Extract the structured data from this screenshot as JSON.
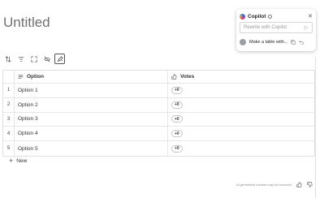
{
  "page": {
    "title": "Untitled"
  },
  "toolbar": {
    "icons": [
      "sort-icon",
      "filter-icon",
      "expand-icon",
      "hide-icon",
      "copilot-edit-icon"
    ]
  },
  "table": {
    "headers": {
      "option": "Option",
      "votes": "Votes"
    },
    "rows": [
      {
        "num": "1",
        "option": "Option 1",
        "votes": "+0"
      },
      {
        "num": "2",
        "option": "Option 2",
        "votes": "+0"
      },
      {
        "num": "3",
        "option": "Option 3",
        "votes": "+0"
      },
      {
        "num": "4",
        "option": "Option 4",
        "votes": "+0"
      },
      {
        "num": "5",
        "option": "Option 5",
        "votes": "+0"
      }
    ],
    "new_label": "New"
  },
  "copilot": {
    "title": "Copilot",
    "input_placeholder": "Rewrite with Copilot",
    "suggestion": "Make a table with..."
  },
  "footer": {
    "disclaimer": "AI-generated content may be incorrect"
  }
}
